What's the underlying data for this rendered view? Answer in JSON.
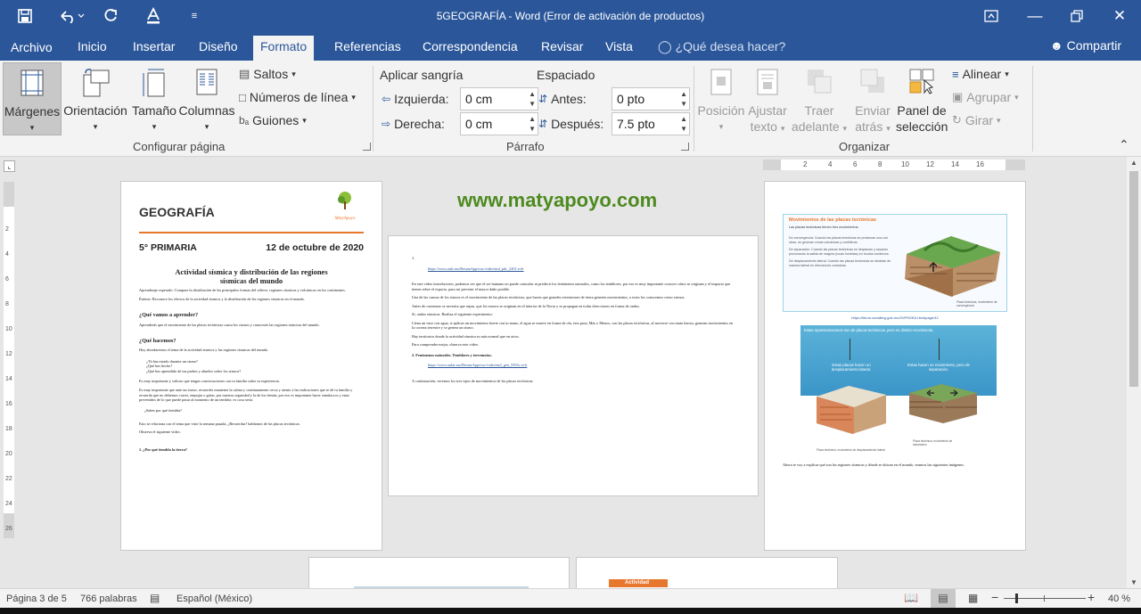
{
  "window": {
    "title": "5GEOGRAFÍA - Word (Error de activación de productos)"
  },
  "tabs": [
    {
      "label": "Archivo"
    },
    {
      "label": "Inicio"
    },
    {
      "label": "Insertar"
    },
    {
      "label": "Diseño"
    },
    {
      "label": "Formato"
    },
    {
      "label": "Referencias"
    },
    {
      "label": "Correspondencia"
    },
    {
      "label": "Revisar"
    },
    {
      "label": "Vista"
    }
  ],
  "tell_me": "¿Qué desea hacer?",
  "share": "Compartir",
  "ribbon": {
    "page_setup": {
      "margins": "Márgenes",
      "orientation": "Orientación",
      "size": "Tamaño",
      "columns": "Columnas",
      "breaks": "Saltos",
      "line_numbers": "Números de línea",
      "hyphenation": "Guiones",
      "label": "Configurar página"
    },
    "paragraph": {
      "indent_title": "Aplicar sangría",
      "spacing_title": "Espaciado",
      "left_label": "Izquierda:",
      "left_value": "0 cm",
      "right_label": "Derecha:",
      "right_value": "0 cm",
      "before_label": "Antes:",
      "before_value": "0 pto",
      "after_label": "Después:",
      "after_value": "7.5 pto",
      "label": "Párrafo"
    },
    "arrange": {
      "position": "Posición",
      "wrap_1": "Ajustar",
      "wrap_2": "texto",
      "forward_1": "Traer",
      "forward_2": "adelante",
      "backward_1": "Enviar",
      "backward_2": "atrás",
      "pane_1": "Panel de",
      "pane_2": "selección",
      "align": "Alinear",
      "group": "Agrupar",
      "rotate": "Girar",
      "label": "Organizar"
    }
  },
  "ruler": {
    "ticks": [
      "2",
      "4",
      "6",
      "8",
      "10",
      "12",
      "14",
      "16"
    ]
  },
  "vruler": {
    "ticks": [
      "2",
      "4",
      "6",
      "8",
      "10",
      "12",
      "14",
      "16",
      "18",
      "20",
      "22",
      "24",
      "26"
    ]
  },
  "page1": {
    "title": "GEOGRAFÍA",
    "logo_text": "MatyApoyo",
    "grade": "5° PRIMARIA",
    "date": "12 de octubre de 2020",
    "activity_1": "Actividad sísmica y distribución de las regiones",
    "activity_2": "sísmicas del mundo",
    "learning": "Aprendizaje esperado: Compara la distribución de las principales formas del relieve, regiones sísmicas y volcánicas en los continentes.",
    "emphasis": "Énfasis: Reconoce los efectos de la actividad sísmica y la distribución de las regiones sísmicas en el mundo.",
    "h1": "¿Qué vamos a aprender?",
    "p1": "Aprenderás que el movimiento de las placas tectónicas causa los sismos y conocerás las regiones sísmicas del mundo.",
    "h2": "¿Qué hacemos?",
    "p2": "Hoy abordaremos el tema de la actividad sísmica y las regiones sísmicas del mundo.",
    "bullets": [
      "¿Tú has estado durante un sismo?",
      "¿Qué has hecho?",
      "¿Qué has aprendido de tus padres y abuelos sobre los sismos?"
    ],
    "p3": "Es muy importante y valioso que tengas conversaciones con tu familia sobre tu experiencia.",
    "p4": "Es muy importante que ante un sismo, recuerdes mantener la calma y continuamente cerca y atento a las indicaciones que te dé tu familia y recuerda que no debemos correr, empujar o gritar, por nuestra seguridad y la de los demás, por eso es importante hacer simulacros y estar prevenidos de lo que puede pasar al momento de un temblor, es cosa seria.",
    "q1": "¿Sabes por qué tiembla?",
    "p5": "Esto se relaciona con el tema que viste la semana pasada, ¿Recuerdas? hablamos de las placas tectónicas.",
    "p6": "Observa el siguiente video.",
    "item1": "1.   ¿Por qué tiembla la tierra?"
  },
  "watermark": "www.matyapoyo.com",
  "page2": {
    "link1": "https://www.ault.mx/ResearApps/src/video/md_pdc_2201.evlr",
    "p1": "En este video introductorio, podemos ver que el ser humano no puede controlar ni predecir los fenómenos naturales, como los temblores, por eso es muy importante conocer cómo se originan y el impacto que tienen sobre el espacio, para así prevenir el mayor daño posible.",
    "p2": "Una de las causas de los sismos es el movimiento de las placas tectónicas, que hacen que grandes extensiones de tierra generen movimientos, a estos los conocemos como sismos.",
    "p3": "Antes de comenzar se necesita que sepas, que los sismos se originan en el interior de la Tierra y se propagan en todas direcciones en forma de ondas.",
    "p4": "Sí, ondas sísmicas. Realiza el siguiente experimento:",
    "p5": "Llena un vaso con agua, si aplicas un movimiento fuerte con tu mano, el agua se mueve en forma de ola, esto pasa, Más o Menos, con las placas tectónicas, al moverse con tanta fuerza, generan movimientos en la corteza terrestre y se genera un sismo.",
    "p6": "Hay territorios donde la actividad sísmica es más normal que en otros.",
    "p7": "Para comprender mejor, observa este video.",
    "item2": "2.   Fenómenos naturales. Temblores y terremotos.",
    "link2": "https://www.aulat.mx/ResearApps/src/video/md_gen_5503c.evlr",
    "p8": "A continuación, veremos los tres tipos de movimientos de las placas tectónicas:"
  },
  "page3": {
    "figure_title": "Movimientos de las placas tectónicas",
    "intro": "Las placas tectónicas tienen tres movimientos:",
    "items": [
      "De convergencia: Cuando las placas tectónicas se presionan una con otras, se generan zonas volcánicas y cordilleras.",
      "De separación: Cuando las placas tectónicas se desplazan y separan provocando la salida de magma (rocas fundidas) en fondos oceánicos.",
      "De desplazamiento lateral: Cuando las placas tectónicas se deslizan de manera lateral en direcciones contrarias."
    ],
    "caption1": "Placa tectónica, movimiento de convergencia",
    "link": "https://libros.conaliteg.gob.mx/20/P5GEA.htm#page/42",
    "fig2_title": "Estas representaciones son de placas tectónicas, pero en distinto movimiento.",
    "fig2_left": "Estas placas hacen un desplazamiento lateral.",
    "fig2_right": "Estas hacen un movimiento, pero de separación.",
    "fig2_cap_left": "Placa tectónica, movimiento de desplazamiento lateral",
    "fig2_cap_right": "Placa tectónica, movimiento de separación",
    "outro": "Ahora te voy a explicar qué son las regiones sísmicas y dónde se ubican en el mundo, veamos las siguientes imágenes."
  },
  "page5": {
    "tag": "Actividad"
  },
  "status": {
    "page": "Página 3 de 5",
    "words": "766 palabras",
    "lang": "Español (México)",
    "zoom": "40 %"
  },
  "colors": {
    "accent": "#2b579a",
    "orange": "#e8772e",
    "green": "#4d8a1f"
  }
}
